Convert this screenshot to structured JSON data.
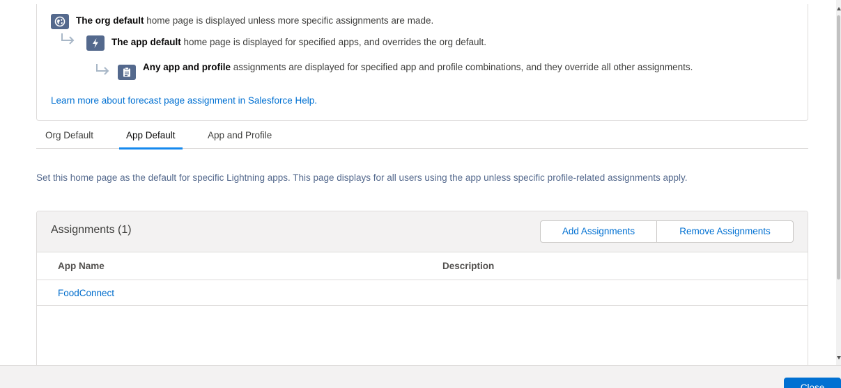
{
  "info": {
    "tiers": [
      {
        "bold": "The org default",
        "text": " home page is displayed unless more specific assignments are made.",
        "icon": "globe-icon"
      },
      {
        "bold": "The app default",
        "text": " home page is displayed for specified apps, and overrides the org default.",
        "icon": "lightning-icon"
      },
      {
        "bold": "Any app and profile",
        "text": " assignments are displayed for specified app and profile combinations, and they override all other assignments.",
        "icon": "clipboard-icon"
      }
    ],
    "help_link": "Learn more about forecast page assignment in Salesforce Help."
  },
  "tabs": [
    {
      "label": "Org Default",
      "active": false
    },
    {
      "label": "App Default",
      "active": true
    },
    {
      "label": "App and Profile",
      "active": false
    }
  ],
  "description": "Set this home page as the default for specific Lightning apps. This page displays for all users using the app unless specific profile-related assignments apply.",
  "assignments": {
    "title": "Assignments (1)",
    "add_label": "Add Assignments",
    "remove_label": "Remove Assignments",
    "columns": [
      "App Name",
      "Description"
    ],
    "rows": [
      {
        "app_name": "FoodConnect",
        "description": ""
      }
    ]
  },
  "footer": {
    "close_label": "Close"
  },
  "colors": {
    "link": "#0070d2",
    "icon_bg": "#54698d",
    "active_tab": "#1589ee",
    "primary_button": "#0070d2"
  }
}
